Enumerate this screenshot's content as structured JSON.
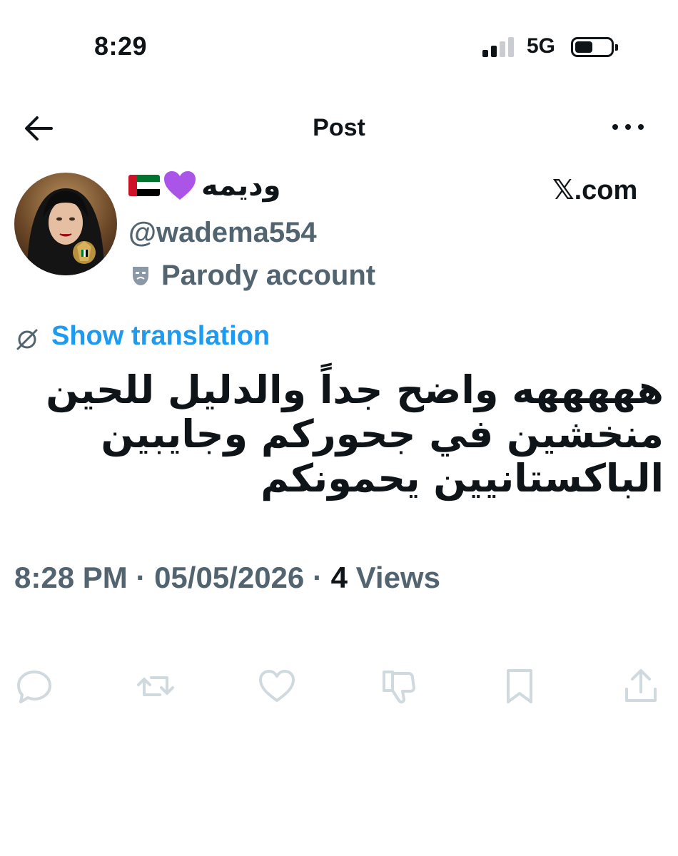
{
  "status_bar": {
    "time": "8:29",
    "network": "5G",
    "signal_bars_filled": 2,
    "signal_bars_total": 4
  },
  "header": {
    "title": "Post",
    "back_icon": "arrow-left-icon",
    "more_icon": "more-horizontal-icon"
  },
  "author": {
    "display_name": "وديمه",
    "emoji": [
      "purple-heart",
      "uae-flag"
    ],
    "handle": "@wadema554",
    "parody_label": "Parody account",
    "watermark": "𝕏.com"
  },
  "tweet": {
    "translation_link": "Show translation",
    "lines": [
      "هههههه واضح جداً والدليل للحين",
      "منخشين في جحوركم وجايبين",
      "الباكستانيين يحمونكم"
    ],
    "time": "8:28 PM",
    "date": "05/05/2026",
    "view_count": "4",
    "views_label": "Views"
  },
  "actions": [
    "reply-icon",
    "repost-icon",
    "like-icon",
    "dislike-icon",
    "bookmark-icon",
    "share-icon"
  ],
  "colors": {
    "text": "#0f1419",
    "secondary": "#536471",
    "link": "#1d9bf0",
    "action_icon": "#cfd9de"
  }
}
